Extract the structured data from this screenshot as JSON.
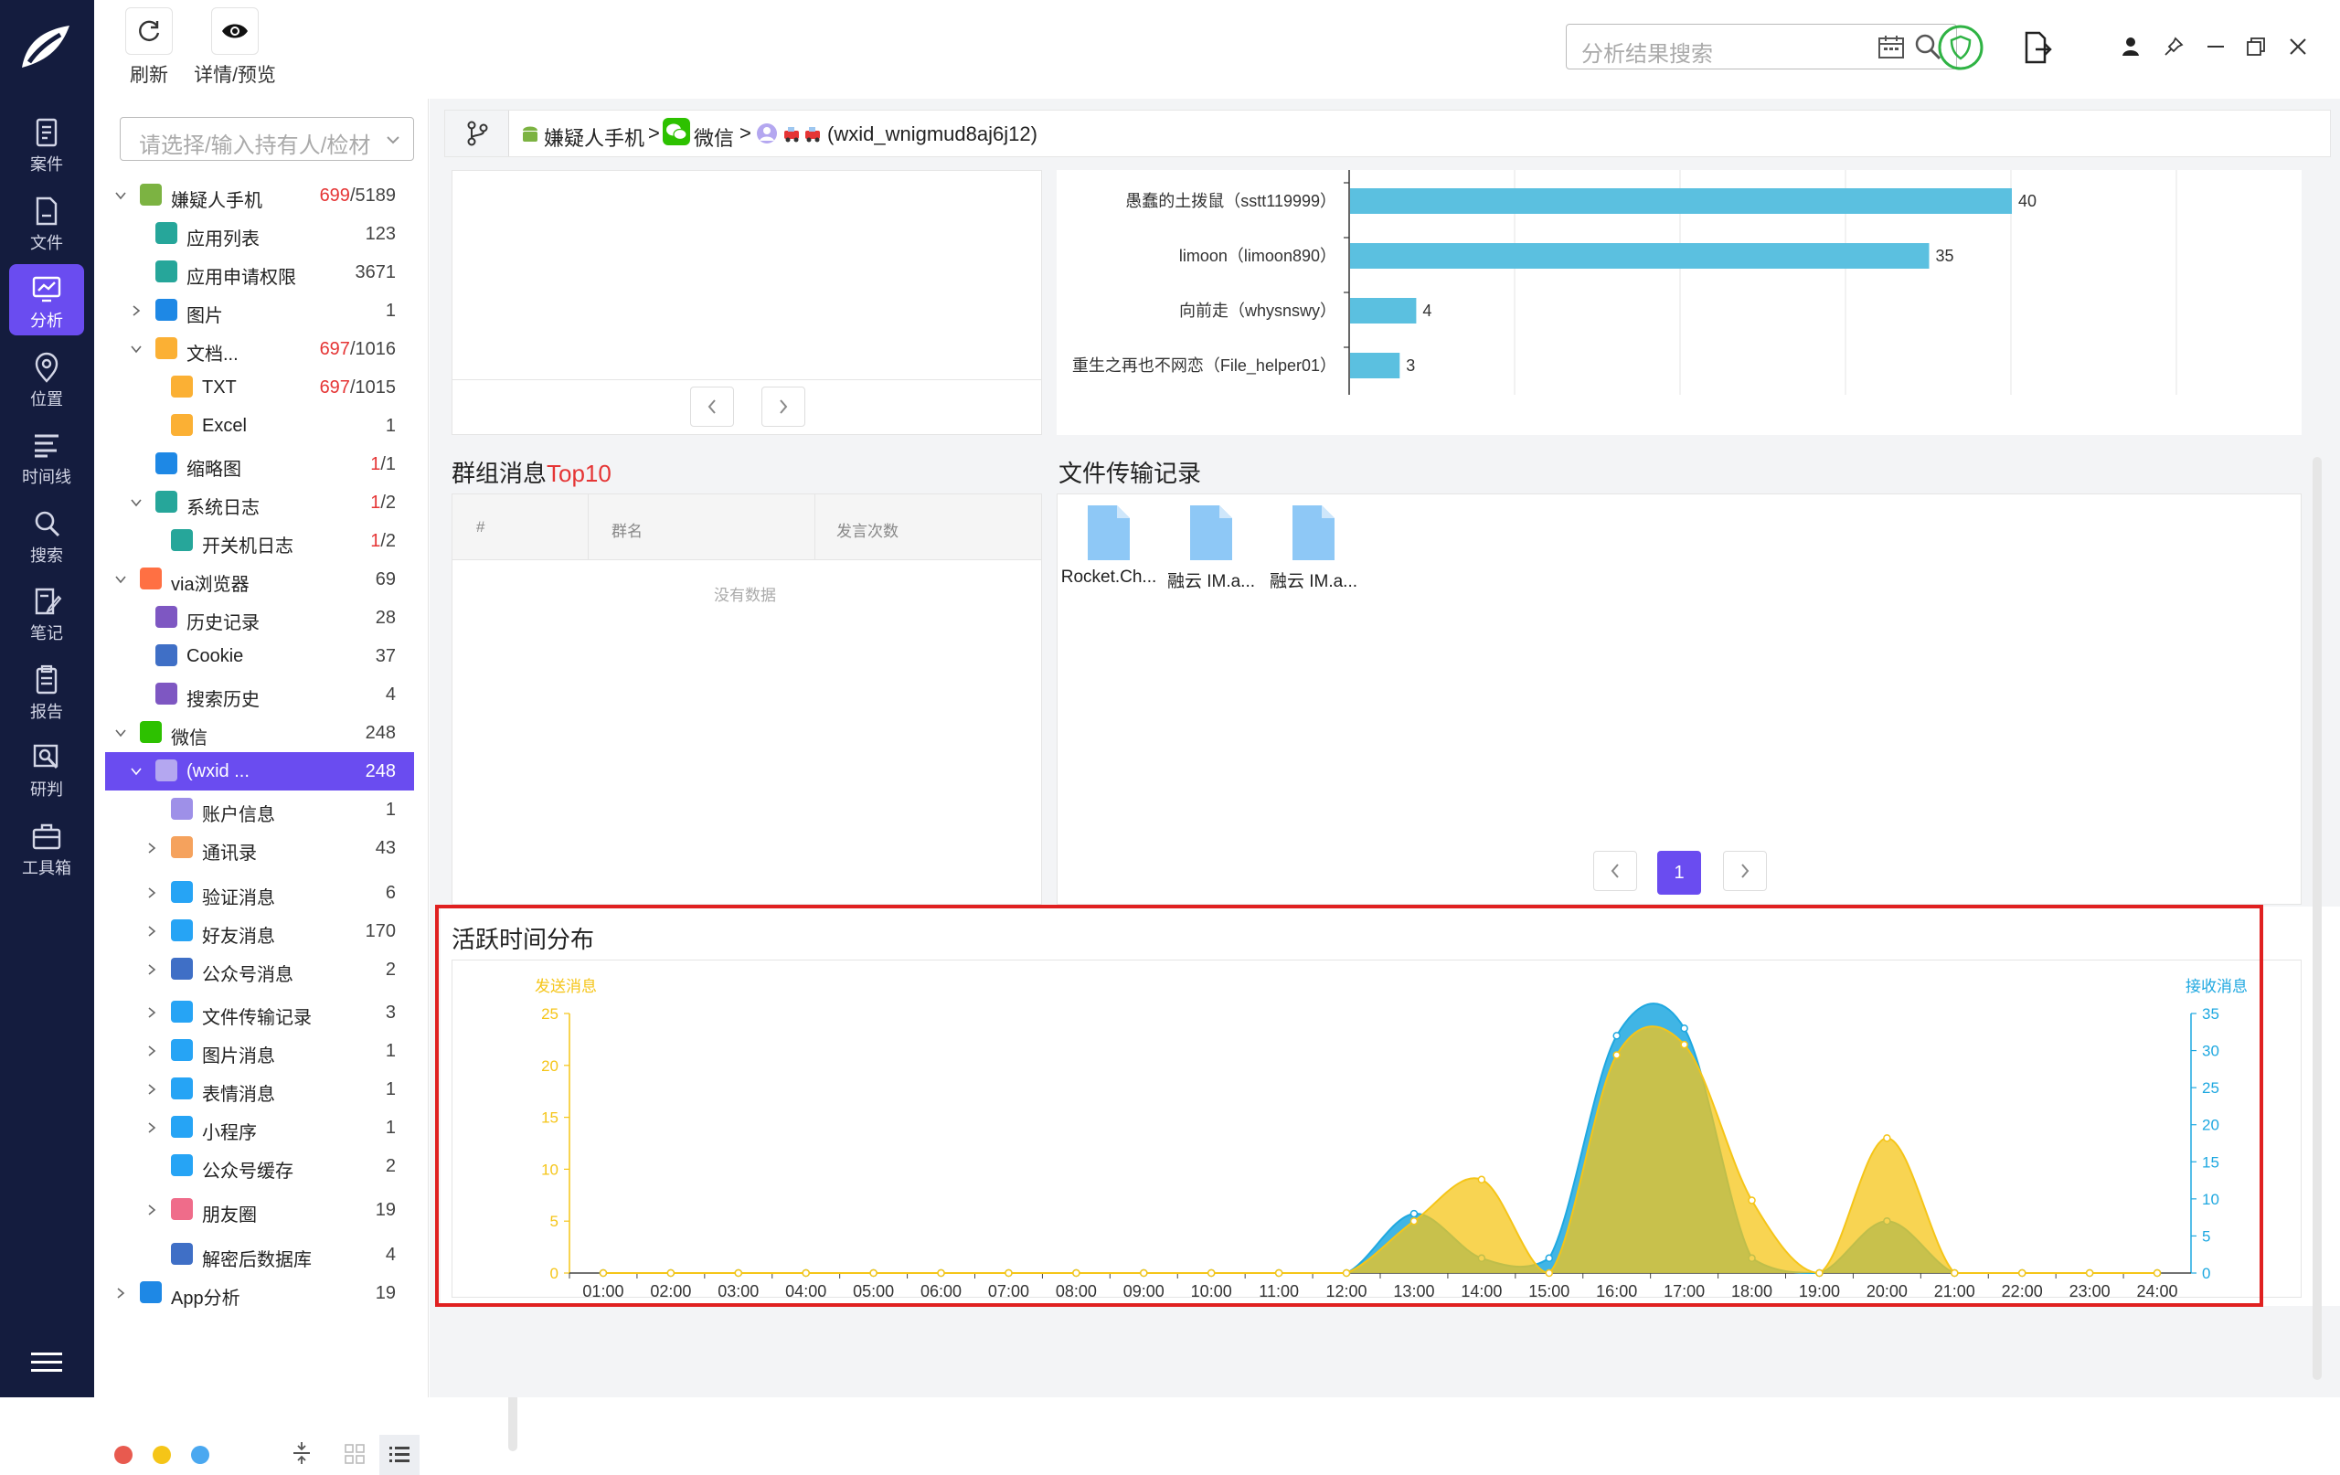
{
  "rail": {
    "items": [
      {
        "label": "案件",
        "icon": "case-icon"
      },
      {
        "label": "文件",
        "icon": "file-icon"
      },
      {
        "label": "分析",
        "icon": "analysis-icon"
      },
      {
        "label": "位置",
        "icon": "location-icon"
      },
      {
        "label": "时间线",
        "icon": "timeline-icon"
      },
      {
        "label": "搜索",
        "icon": "search-icon"
      },
      {
        "label": "笔记",
        "icon": "note-icon"
      },
      {
        "label": "报告",
        "icon": "report-icon"
      },
      {
        "label": "研判",
        "icon": "judge-icon"
      },
      {
        "label": "工具箱",
        "icon": "toolbox-icon"
      }
    ],
    "active_index": 2
  },
  "toolbar": {
    "refresh_label": "刷新",
    "detail_label": "详情/预览"
  },
  "search": {
    "placeholder": "分析结果搜索"
  },
  "tree": {
    "select_placeholder": "请选择/输入持有人/检材",
    "rows": [
      {
        "label": "嫌疑人手机",
        "count_red": "699",
        "count": "/5189"
      },
      {
        "label": "应用列表",
        "count": "123"
      },
      {
        "label": "应用申请权限",
        "count": "3671"
      },
      {
        "label": "图片",
        "count": "1"
      },
      {
        "label": "文档...",
        "count_red": "697",
        "count": "/1016"
      },
      {
        "label": "TXT",
        "count_red": "697",
        "count": "/1015"
      },
      {
        "label": "Excel",
        "count": "1"
      },
      {
        "label": "缩略图",
        "count_red": "1",
        "count": "/1"
      },
      {
        "label": "系统日志",
        "count_red": "1",
        "count": "/2"
      },
      {
        "label": "开关机日志",
        "count_red": "1",
        "count": "/2"
      },
      {
        "label": "via浏览器",
        "count": "69"
      },
      {
        "label": "历史记录",
        "count": "28"
      },
      {
        "label": "Cookie",
        "count": "37"
      },
      {
        "label": "搜索历史",
        "count": "4"
      },
      {
        "label": "微信",
        "count": "248"
      },
      {
        "label": "(wxid ...",
        "count": "248"
      },
      {
        "label": "账户信息",
        "count": "1"
      },
      {
        "label": "通讯录",
        "count": "43"
      },
      {
        "label": "验证消息",
        "count": "6"
      },
      {
        "label": "好友消息",
        "count": "170"
      },
      {
        "label": "公众号消息",
        "count": "2"
      },
      {
        "label": "文件传输记录",
        "count": "3"
      },
      {
        "label": "图片消息",
        "count": "1"
      },
      {
        "label": "表情消息",
        "count": "1"
      },
      {
        "label": "小程序",
        "count": "1"
      },
      {
        "label": "公众号缓存",
        "count": "2"
      },
      {
        "label": "朋友圈",
        "count": "19"
      },
      {
        "label": "解密后数据库",
        "count": "4"
      },
      {
        "label": "App分析",
        "count": "19"
      }
    ]
  },
  "breadcrumb": {
    "device": "嫌疑人手机",
    "app": "微信",
    "account": "(wxid_wnigmud8aj6j12)",
    "sep": ">"
  },
  "group_top": {
    "title": "群组消息",
    "title_red": "Top10",
    "cols": [
      "#",
      "群名",
      "发言次数"
    ],
    "empty": "没有数据"
  },
  "files": {
    "title": "文件传输记录",
    "items": [
      "Rocket.Ch...",
      "融云 IM.a...",
      "融云 IM.a..."
    ],
    "page": "1"
  },
  "activity": {
    "title": "活跃时间分布"
  },
  "chart_data": [
    {
      "type": "bar",
      "orientation": "horizontal",
      "categories": [
        "愚蠢的土拨鼠（sstt119999）",
        "limoon（limoon890）",
        "向前走（whysnswy）",
        "重生之再也不网恋（File_helper01）"
      ],
      "values": [
        40,
        35,
        4,
        3
      ],
      "color": "#5bc0e0"
    },
    {
      "type": "area",
      "x": [
        "01:00",
        "02:00",
        "03:00",
        "04:00",
        "05:00",
        "06:00",
        "07:00",
        "08:00",
        "09:00",
        "10:00",
        "11:00",
        "12:00",
        "13:00",
        "14:00",
        "15:00",
        "16:00",
        "17:00",
        "18:00",
        "19:00",
        "20:00",
        "21:00",
        "22:00",
        "23:00",
        "24:00"
      ],
      "series": [
        {
          "name": "发送消息",
          "axis": "left",
          "color": "#f5c518",
          "values": [
            0,
            0,
            0,
            0,
            0,
            0,
            0,
            0,
            0,
            0,
            0,
            0,
            5,
            9,
            0,
            21,
            22,
            7,
            0,
            13,
            0,
            0,
            0,
            0
          ]
        },
        {
          "name": "接收消息",
          "axis": "right",
          "color": "#1fa8e0",
          "values": [
            0,
            0,
            0,
            0,
            0,
            0,
            0,
            0,
            0,
            0,
            0,
            0,
            8,
            2,
            2,
            32,
            33,
            2,
            0,
            7,
            0,
            0,
            0,
            0
          ]
        }
      ],
      "yleft": {
        "label": "发送消息",
        "ticks": [
          "0",
          "5",
          "10",
          "15",
          "20",
          "25"
        ],
        "range": [
          0,
          25
        ]
      },
      "yright": {
        "label": "接收消息",
        "ticks": [
          "0",
          "5",
          "10",
          "15",
          "20",
          "25",
          "30",
          "35"
        ],
        "range": [
          0,
          35
        ]
      }
    }
  ]
}
